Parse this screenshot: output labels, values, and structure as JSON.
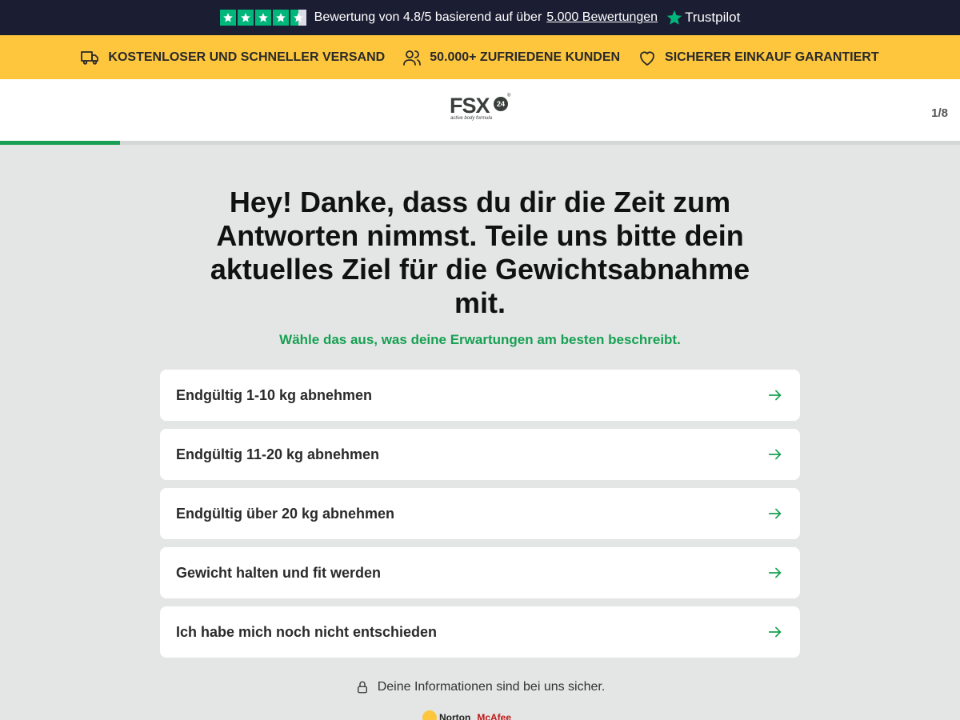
{
  "rating_bar": {
    "text": "Bewertung von 4.8/5 basierend auf über",
    "link": "5.000 Bewertungen",
    "brand": "Trustpilot",
    "stars": 4.5,
    "star_color": "#00b67a"
  },
  "benefits": [
    {
      "icon": "truck-icon",
      "label": "KOSTENLOSER UND SCHNELLER VERSAND"
    },
    {
      "icon": "users-icon",
      "label": "50.000+ ZUFRIEDENE KUNDEN"
    },
    {
      "icon": "heart-icon",
      "label": "SICHERER EINKAUF GARANTIERT"
    }
  ],
  "header": {
    "logo_main": "FSX",
    "logo_badge": "24",
    "logo_reg": "®",
    "logo_tagline": "active body formula",
    "step": "1/8"
  },
  "progress": {
    "fraction": 0.125,
    "color": "#17a053"
  },
  "main": {
    "question": "Hey! Danke, dass du dir die Zeit zum Antworten nimmst. Teile uns bitte dein aktuelles Ziel für die Gewichtsabnahme mit.",
    "subtitle": "Wähle das aus, was deine Erwartungen am besten beschreibt.",
    "options": [
      "Endgültig 1-10 kg abnehmen",
      "Endgültig 11-20 kg abnehmen",
      "Endgültig über 20 kg abnehmen",
      "Gewicht halten und fit werden",
      "Ich habe mich noch nicht entschieden"
    ],
    "secure_note": "Deine Informationen sind bei uns sicher."
  },
  "trust": {
    "norton": "Norton",
    "mcafee": "McAfee"
  },
  "colors": {
    "top_bar": "#1b1d33",
    "benefit_bar": "#fec63d",
    "accent_green": "#17a053",
    "background": "#e3e6e4"
  }
}
